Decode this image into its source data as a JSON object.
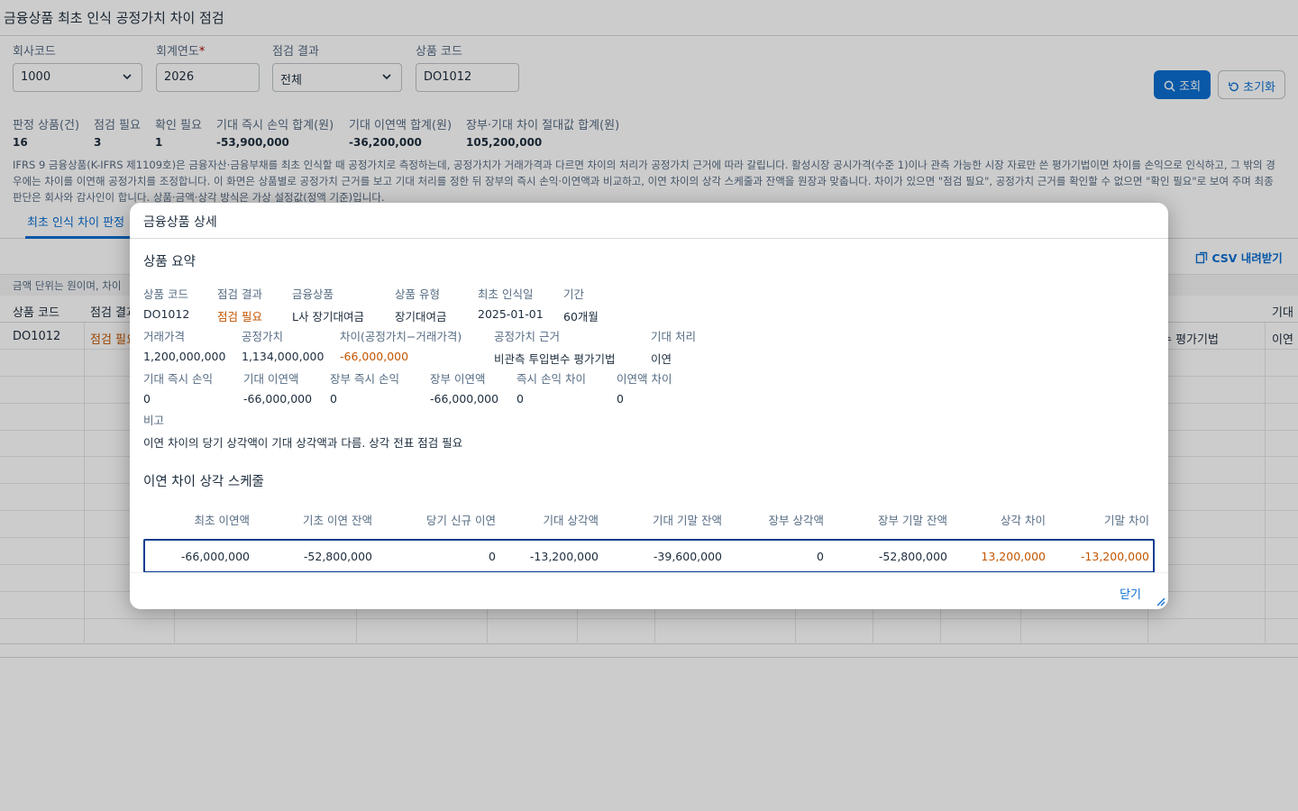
{
  "page": {
    "title": "금융상품 최초 인식 공정가치 차이 점검"
  },
  "filters": {
    "company_code": {
      "label": "회사코드",
      "value": "1000"
    },
    "fiscal_year": {
      "label": "회계연도",
      "required_mark": "*",
      "value": "2026"
    },
    "check_result": {
      "label": "점검 결과",
      "value": "전체"
    },
    "product_code": {
      "label": "상품 코드",
      "value": "DO1012"
    },
    "go_label": "조회",
    "reset_label": "초기화"
  },
  "kpis": [
    {
      "label": "판정 상품(건)",
      "value": "16"
    },
    {
      "label": "점검 필요",
      "value": "3"
    },
    {
      "label": "확인 필요",
      "value": "1"
    },
    {
      "label": "기대 즉시 손익 합계(원)",
      "value": "-53,900,000"
    },
    {
      "label": "기대 이연액 합계(원)",
      "value": "-36,200,000"
    },
    {
      "label": "장부·기대 차이 절대값 합계(원)",
      "value": "105,200,000"
    }
  ],
  "intro": "IFRS 9 금융상품(K-IFRS 제1109호)은 금융자산·금융부채를 최초 인식할 때 공정가치로 측정하는데, 공정가치가 거래가격과 다르면 차이의 처리가 공정가치 근거에 따라 갈립니다. 활성시장 공시가격(수준 1)이나 관측 가능한 시장 자료만 쓴 평가기법이면 차이를 손익으로 인식하고, 그 밖의 경우에는 차이를 이연해 공정가치를 조정합니다. 이 화면은 상품별로 공정가치 근거를 보고 기대 처리를 정한 뒤 장부의 즉시 손익·이연액과 비교하고, 이연 차이의 상각 스케줄과 잔액을 원장과 맞춥니다. 차이가 있으면 \"점검 필요\", 공정가치 근거를 확인할 수 없으면 \"확인 필요\"로 보여 주며 최종 판단은 회사와 감사인이 합니다. 상품·금액·상각 방식은 가상 설정값(정액 기준)입니다.",
  "tabs": {
    "active": "최초 인식 차이 판정"
  },
  "csv_label": "CSV 내려받기",
  "unit_note": "금액 단위는 원이며, 차이",
  "grid": {
    "headers": [
      "상품 코드",
      "점검 결과",
      "기대"
    ],
    "row": {
      "code": "DO1012",
      "result": "점검 필요",
      "basis_tail": "수 평가기법",
      "treatment": "이연"
    }
  },
  "dialog": {
    "title": "금융상품 상세",
    "summary_title": "상품 요약",
    "row1": [
      {
        "label": "상품 코드",
        "value": "DO1012"
      },
      {
        "label": "점검 결과",
        "value": "점검 필요"
      },
      {
        "label": "금융상품",
        "value": "L사 장기대여금"
      },
      {
        "label": "상품 유형",
        "value": "장기대여금"
      },
      {
        "label": "최초 인식일",
        "value": "2025-01-01"
      },
      {
        "label": "기간",
        "value": "60개월"
      }
    ],
    "row2": [
      {
        "label": "거래가격",
        "value": "1,200,000,000"
      },
      {
        "label": "공정가치",
        "value": "1,134,000,000"
      },
      {
        "label": "차이(공정가치−거래가격)",
        "value": "-66,000,000"
      },
      {
        "label": "공정가치 근거",
        "value": "비관측 투입변수 평가기법"
      },
      {
        "label": "기대 처리",
        "value": "이연"
      }
    ],
    "row3": [
      {
        "label": "기대 즉시 손익",
        "value": "0"
      },
      {
        "label": "기대 이연액",
        "value": "-66,000,000"
      },
      {
        "label": "장부 즉시 손익",
        "value": "0"
      },
      {
        "label": "장부 이연액",
        "value": "-66,000,000"
      },
      {
        "label": "즉시 손익 차이",
        "value": "0"
      },
      {
        "label": "이연액 차이",
        "value": "0"
      }
    ],
    "note_label": "비고",
    "note_value": "이연 차이의 당기 상각액이 기대 상각액과 다름. 상각 전표 점검 필요",
    "schedule_title": "이연 차이 상각 스케줄",
    "schedule_headers": [
      "최초 이연액",
      "기초 이연 잔액",
      "당기 신규 이연",
      "기대 상각액",
      "기대 기말 잔액",
      "장부 상각액",
      "장부 기말 잔액",
      "상각 차이",
      "기말 차이"
    ],
    "schedule_row": [
      "-66,000,000",
      "-52,800,000",
      "0",
      "-13,200,000",
      "-39,600,000",
      "0",
      "-52,800,000",
      "13,200,000",
      "-13,200,000"
    ],
    "close_label": "닫기"
  },
  "colors": {
    "accent": "#0a6ed1",
    "warning": "#c35500",
    "overlay": "rgba(0,0,0,0.2)"
  }
}
